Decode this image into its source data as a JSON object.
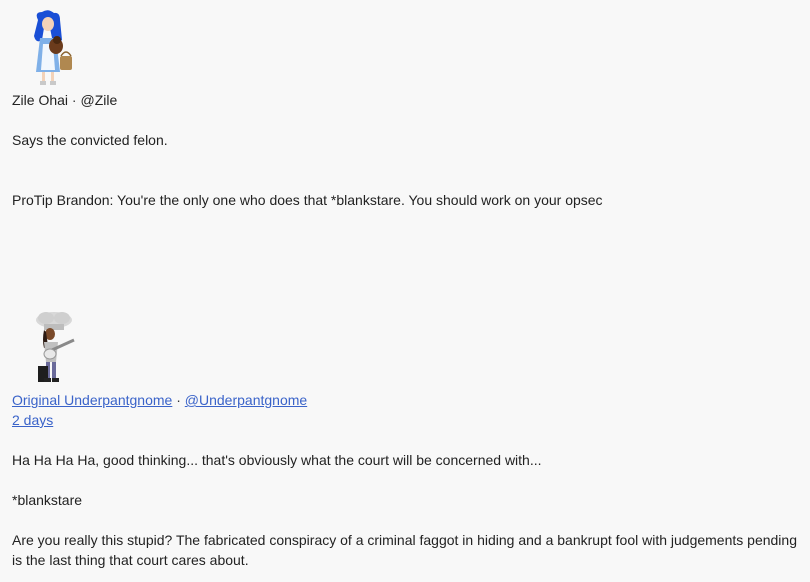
{
  "posts": [
    {
      "author_name": "Zile Ohai",
      "separator": "·",
      "author_handle": "@Zile",
      "avatar_icon": "avatar-blue-hair-girl-with-dog-icon",
      "paragraphs": [
        "Says the convicted felon.",
        "ProTip Brandon: You're the only one who does that *blankstare. You should work on your opsec"
      ]
    },
    {
      "author_name": "Original Underpantgnome",
      "separator": "·",
      "author_handle": "@Underpantgnome",
      "avatar_icon": "avatar-chef-hat-guitarist-icon",
      "date": "2 days",
      "paragraphs": [
        "Ha Ha Ha Ha, good thinking... that's obviously what the court will be concerned with...",
        "*blankstare",
        "Are you really this stupid? The fabricated conspiracy of a criminal faggot in hiding and a bankrupt fool with judgements pending is the last thing that court cares about."
      ]
    }
  ]
}
